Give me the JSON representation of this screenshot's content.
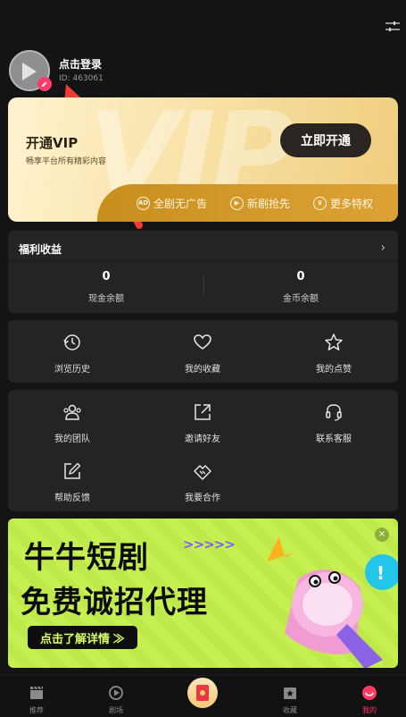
{
  "profile": {
    "login_title": "点击登录",
    "user_id": "ID: 463061"
  },
  "vip": {
    "title": "开通VIP",
    "subtitle": "畅享平台所有精彩内容",
    "button": "立即开通",
    "watermark": "VIP",
    "perks": [
      {
        "label": "全剧无广告",
        "icon": "ad-free-icon"
      },
      {
        "label": "新剧抢先",
        "icon": "play-early-icon"
      },
      {
        "label": "更多特权",
        "icon": "crown-icon"
      }
    ]
  },
  "welfare": {
    "title": "福利收益",
    "cash": {
      "value": "0",
      "label": "现金余额"
    },
    "coins": {
      "value": "0",
      "label": "金币余额"
    }
  },
  "menu_row1": [
    {
      "label": "浏览历史",
      "icon": "history-icon"
    },
    {
      "label": "我的收藏",
      "icon": "heart-icon"
    },
    {
      "label": "我的点赞",
      "icon": "star-icon"
    }
  ],
  "menu_row2": [
    {
      "label": "我的团队",
      "icon": "team-icon"
    },
    {
      "label": "邀请好友",
      "icon": "share-icon"
    },
    {
      "label": "联系客服",
      "icon": "headset-icon"
    }
  ],
  "menu_row3": [
    {
      "label": "帮助反馈",
      "icon": "feedback-icon"
    },
    {
      "label": "我要合作",
      "icon": "handshake-icon"
    }
  ],
  "banner": {
    "line1": "牛牛短剧",
    "line2": "免费诚招代理",
    "arrows": ">>>>>",
    "button": "点击了解详情 ≫",
    "close": "×"
  },
  "tabs": [
    {
      "label": "推荐",
      "icon": "clapperboard-icon"
    },
    {
      "label": "剧场",
      "icon": "play-circle-icon"
    },
    {
      "label": "",
      "icon": "red-packet-icon"
    },
    {
      "label": "收藏",
      "icon": "bookmark-icon"
    },
    {
      "label": "我的",
      "icon": "smile-icon"
    }
  ],
  "colors": {
    "background": "#141414",
    "card": "#242424",
    "vip_gold": "#c98f1d",
    "active_tab": "#ff3c5f",
    "banner_green": "#c6ef52"
  }
}
